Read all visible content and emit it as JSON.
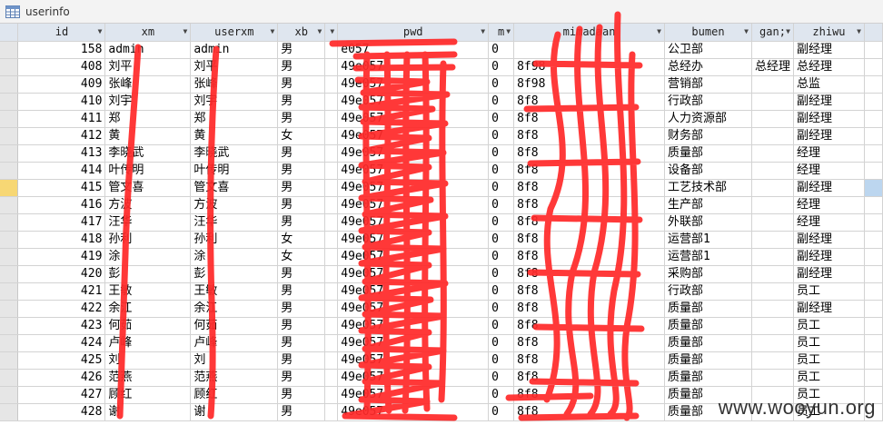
{
  "window": {
    "title": "userinfo"
  },
  "columns": [
    {
      "key": "id",
      "label": "id"
    },
    {
      "key": "xm",
      "label": "xm"
    },
    {
      "key": "userxm",
      "label": "userxm"
    },
    {
      "key": "xb",
      "label": "xb"
    },
    {
      "key": "c5",
      "label": ""
    },
    {
      "key": "pwd",
      "label": "pwd"
    },
    {
      "key": "m",
      "label": "m"
    },
    {
      "key": "mimadaan",
      "label": "mimadaan"
    },
    {
      "key": "bumen",
      "label": "bumen"
    },
    {
      "key": "gang",
      "label": "gan;"
    },
    {
      "key": "zhiwu",
      "label": "zhiwu"
    }
  ],
  "rows": [
    {
      "id": "158",
      "xm": "admin",
      "userxm": "admin",
      "xb": "男",
      "c5": "",
      "pwd": "e057",
      "m": "0",
      "mimadaan": "",
      "bumen": "公卫部",
      "gang": "",
      "zhiwu": "副经理"
    },
    {
      "id": "408",
      "xm": "刘平",
      "userxm": "刘平",
      "xb": "男",
      "c5": "",
      "pwd": "49e057",
      "m": "0",
      "mimadaan": "8f98",
      "bumen": "总经办",
      "gang": "总经理",
      "zhiwu": "总经理"
    },
    {
      "id": "409",
      "xm": "张峰",
      "userxm": "张峰",
      "xb": "男",
      "c5": "",
      "pwd": "49e057",
      "m": "0",
      "mimadaan": "8f98",
      "bumen": "营销部",
      "gang": "",
      "zhiwu": "总监"
    },
    {
      "id": "410",
      "xm": "刘宇",
      "userxm": "刘宇",
      "xb": "男",
      "c5": "",
      "pwd": "49e057",
      "m": "0",
      "mimadaan": "8f8",
      "bumen": "行政部",
      "gang": "",
      "zhiwu": "副经理"
    },
    {
      "id": "411",
      "xm": "郑",
      "userxm": "郑",
      "xb": "男",
      "c5": "",
      "pwd": "49e057",
      "m": "0",
      "mimadaan": "8f8",
      "bumen": "人力资源部",
      "gang": "",
      "zhiwu": "副经理"
    },
    {
      "id": "412",
      "xm": "黄",
      "userxm": "黄",
      "xb": "女",
      "c5": "",
      "pwd": "49e057",
      "m": "0",
      "mimadaan": "8f8",
      "bumen": "财务部",
      "gang": "",
      "zhiwu": "副经理"
    },
    {
      "id": "413",
      "xm": "李晓武",
      "userxm": "李晓武",
      "xb": "男",
      "c5": "",
      "pwd": "49e057",
      "m": "0",
      "mimadaan": "8f8",
      "bumen": "质量部",
      "gang": "",
      "zhiwu": "经理"
    },
    {
      "id": "414",
      "xm": "叶传明",
      "userxm": "叶传明",
      "xb": "男",
      "c5": "",
      "pwd": "49e057",
      "m": "0",
      "mimadaan": "8f8",
      "bumen": "设备部",
      "gang": "",
      "zhiwu": "经理"
    },
    {
      "id": "415",
      "xm": "管文喜",
      "userxm": "管文喜",
      "xb": "男",
      "c5": "",
      "pwd": "49e057",
      "m": "0",
      "mimadaan": "8f8",
      "bumen": "工艺技术部",
      "gang": "",
      "zhiwu": "副经理"
    },
    {
      "id": "416",
      "xm": "方波",
      "userxm": "方波",
      "xb": "男",
      "c5": "",
      "pwd": "49e057",
      "m": "0",
      "mimadaan": "8f8",
      "bumen": "生产部",
      "gang": "",
      "zhiwu": "经理"
    },
    {
      "id": "417",
      "xm": "汪华",
      "userxm": "汪华",
      "xb": "男",
      "c5": "",
      "pwd": "49e057",
      "m": "0",
      "mimadaan": "8f8",
      "bumen": "外联部",
      "gang": "",
      "zhiwu": "经理"
    },
    {
      "id": "418",
      "xm": "孙利",
      "userxm": "孙利",
      "xb": "女",
      "c5": "",
      "pwd": "49e057",
      "m": "0",
      "mimadaan": "8f8",
      "bumen": "运营部1",
      "gang": "",
      "zhiwu": "副经理"
    },
    {
      "id": "419",
      "xm": "涂",
      "userxm": "涂",
      "xb": "女",
      "c5": "",
      "pwd": "49e057",
      "m": "0",
      "mimadaan": "8f8",
      "bumen": "运营部1",
      "gang": "",
      "zhiwu": "副经理"
    },
    {
      "id": "420",
      "xm": "彭",
      "userxm": "彭",
      "xb": "男",
      "c5": "",
      "pwd": "49e057",
      "m": "0",
      "mimadaan": "8f8",
      "bumen": "采购部",
      "gang": "",
      "zhiwu": "副经理"
    },
    {
      "id": "421",
      "xm": "王敏",
      "userxm": "王敏",
      "xb": "男",
      "c5": "",
      "pwd": "49e057",
      "m": "0",
      "mimadaan": "8f8",
      "bumen": "行政部",
      "gang": "",
      "zhiwu": "员工"
    },
    {
      "id": "422",
      "xm": "余江",
      "userxm": "余江",
      "xb": "男",
      "c5": "",
      "pwd": "49e057",
      "m": "0",
      "mimadaan": "8f8",
      "bumen": "质量部",
      "gang": "",
      "zhiwu": "副经理"
    },
    {
      "id": "423",
      "xm": "何茹",
      "userxm": "何茹",
      "xb": "男",
      "c5": "",
      "pwd": "49e057",
      "m": "0",
      "mimadaan": "8f8",
      "bumen": "质量部",
      "gang": "",
      "zhiwu": "员工"
    },
    {
      "id": "424",
      "xm": "卢峰",
      "userxm": "卢峰",
      "xb": "男",
      "c5": "",
      "pwd": "49e057",
      "m": "0",
      "mimadaan": "8f8",
      "bumen": "质量部",
      "gang": "",
      "zhiwu": "员工"
    },
    {
      "id": "425",
      "xm": "刘",
      "userxm": "刘",
      "xb": "男",
      "c5": "",
      "pwd": "49e057",
      "m": "0",
      "mimadaan": "8f8",
      "bumen": "质量部",
      "gang": "",
      "zhiwu": "员工"
    },
    {
      "id": "426",
      "xm": "范燕",
      "userxm": "范燕",
      "xb": "男",
      "c5": "",
      "pwd": "49e057",
      "m": "0",
      "mimadaan": "8f8",
      "bumen": "质量部",
      "gang": "",
      "zhiwu": "员工"
    },
    {
      "id": "427",
      "xm": "顾红",
      "userxm": "顾红",
      "xb": "男",
      "c5": "",
      "pwd": "49e057",
      "m": "0",
      "mimadaan": "8f8",
      "bumen": "质量部",
      "gang": "",
      "zhiwu": "员工"
    },
    {
      "id": "428",
      "xm": "谢",
      "userxm": "谢",
      "xb": "男",
      "c5": "",
      "pwd": "49e057",
      "m": "0",
      "mimadaan": "8f8",
      "bumen": "质量部",
      "gang": "",
      "zhiwu": "员工"
    }
  ],
  "watermark": "www.wooyun.org",
  "colors": {
    "header_bg": "#dfe6ef",
    "current_row_selector": "#f7d774",
    "redaction": "#ff2a2a"
  },
  "icons": {
    "table": "table-icon",
    "sort": "dropdown-arrow-icon"
  }
}
